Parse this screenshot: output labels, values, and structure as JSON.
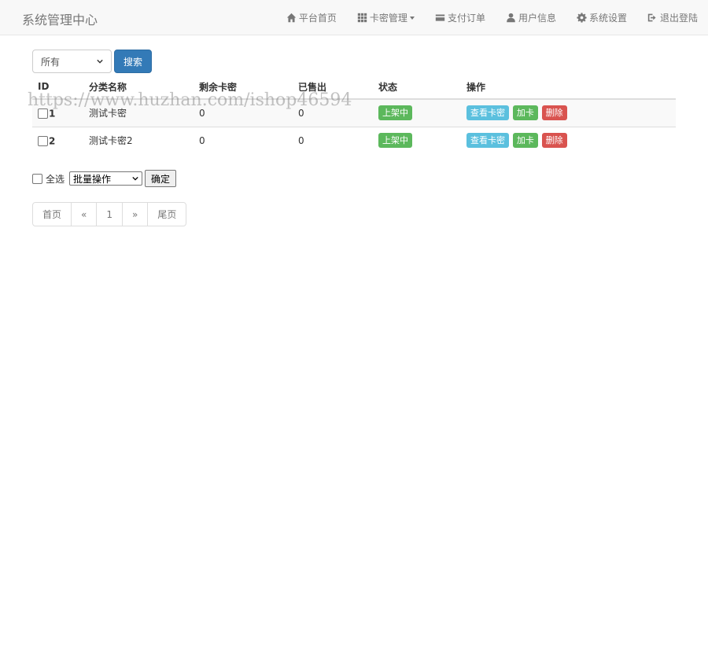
{
  "brand": "系统管理中心",
  "nav": {
    "home": "平台首页",
    "cards": "卡密管理",
    "orders": "支付订单",
    "user": "用户信息",
    "settings": "系统设置",
    "logout": "退出登陆"
  },
  "filter": {
    "selected": "所有",
    "search_label": "搜索"
  },
  "table": {
    "headers": [
      "ID",
      "分类名称",
      "剩余卡密",
      "已售出",
      "状态",
      "操作"
    ],
    "rows": [
      {
        "id": "1",
        "name": "测试卡密",
        "remaining": "0",
        "sold": "0",
        "status": "上架中"
      },
      {
        "id": "2",
        "name": "测试卡密2",
        "remaining": "0",
        "sold": "0",
        "status": "上架中"
      }
    ],
    "actions": {
      "view": "查看卡密",
      "add": "加卡",
      "delete": "删除"
    }
  },
  "batch": {
    "select_all": "全选",
    "operation": "批量操作",
    "confirm": "确定"
  },
  "pagination": [
    "首页",
    "«",
    "1",
    "»",
    "尾页"
  ],
  "watermark": "https://www.huzhan.com/ishop46594",
  "colors": {
    "primary": "#337ab7",
    "success": "#5cb85c",
    "info": "#5bc0de",
    "danger": "#d9534f"
  }
}
